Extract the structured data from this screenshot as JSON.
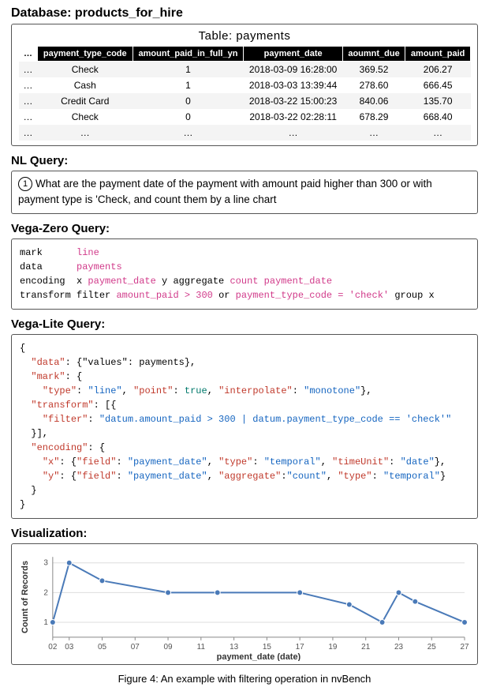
{
  "database_label": "Database: products_for_hire",
  "table": {
    "caption": "Table: payments",
    "headers": [
      "…",
      "payment_type_code",
      "amount_paid_in_full_yn",
      "payment_date",
      "aoumnt_due",
      "amount_paid"
    ],
    "rows": [
      [
        "…",
        "Check",
        "1",
        "2018-03-09 16:28:00",
        "369.52",
        "206.27"
      ],
      [
        "…",
        "Cash",
        "1",
        "2018-03-03 13:39:44",
        "278.60",
        "666.45"
      ],
      [
        "…",
        "Credit Card",
        "0",
        "2018-03-22 15:00:23",
        "840.06",
        "135.70"
      ],
      [
        "…",
        "Check",
        "0",
        "2018-03-22 02:28:11",
        "678.29",
        "668.40"
      ],
      [
        "…",
        "…",
        "…",
        "…",
        "…",
        "…"
      ]
    ]
  },
  "sections": {
    "nl_title": "NL Query:",
    "nl_text": "What are the payment date of the payment with amount paid higher than 300 or with payment type is 'Check, and count them by a line chart",
    "vz_title": "Vega-Zero Query:",
    "vl_title": "Vega-Lite Query:",
    "viz_title": "Visualization:"
  },
  "vega_zero": {
    "l1_kw": "mark",
    "l1_val": "line",
    "l2_kw": "data",
    "l2_val": "payments",
    "l3_kw": "encoding",
    "l3_a": "x",
    "l3_b": "payment_date",
    "l3_c": "y aggregate",
    "l3_d": "count payment_date",
    "l4_kw": "transform",
    "l4_a": "filter",
    "l4_b": "amount_paid > 300",
    "l4_c": "or",
    "l4_d": "payment_type_code = 'check'",
    "l4_e": "group x"
  },
  "vega_lite": {
    "open": "{",
    "data_k": "\"data\"",
    "data_v": ": {\"values\": payments},",
    "mark_k": "\"mark\"",
    "mark_open": ": {",
    "mark_type_k": "\"type\"",
    "mark_type_v": "\"line\"",
    "mark_point_k": "\"point\"",
    "mark_point_v": "true",
    "mark_interp_k": "\"interpolate\"",
    "mark_interp_v": "\"monotone\"",
    "transform_k": "\"transform\"",
    "transform_open": ": [{",
    "filter_k": "\"filter\"",
    "filter_v": "\"datum.amount_paid > 300 | datum.payment_type_code == 'check'\"",
    "transform_close": "}],",
    "encoding_k": "\"encoding\"",
    "encoding_open": ": {",
    "x_k": "\"x\"",
    "x_field_k": "\"field\"",
    "x_field_v": "\"payment_date\"",
    "x_type_k": "\"type\"",
    "x_type_v": "\"temporal\"",
    "x_tu_k": "\"timeUnit\"",
    "x_tu_v": "\"date\"",
    "y_k": "\"y\"",
    "y_field_k": "\"field\"",
    "y_field_v": "\"payment_date\"",
    "y_agg_k": "\"aggregate\"",
    "y_agg_v": "\"count\"",
    "y_type_k": "\"type\"",
    "y_type_v": "\"temporal\"",
    "close": "}"
  },
  "chart_data": {
    "type": "line",
    "xlabel": "payment_date (date)",
    "ylabel": "Count of Records",
    "x_ticks": [
      "02",
      "03",
      "05",
      "07",
      "09",
      "11",
      "13",
      "15",
      "17",
      "19",
      "21",
      "23",
      "25",
      "27"
    ],
    "y_ticks": [
      "1",
      "2",
      "3"
    ],
    "ylim": [
      0.5,
      3.2
    ],
    "series": [
      {
        "name": "count",
        "points": [
          {
            "x": 2,
            "y": 1
          },
          {
            "x": 3,
            "y": 3
          },
          {
            "x": 5,
            "y": 2.4
          },
          {
            "x": 9,
            "y": 2
          },
          {
            "x": 12,
            "y": 2
          },
          {
            "x": 17,
            "y": 2
          },
          {
            "x": 20,
            "y": 1.6
          },
          {
            "x": 22,
            "y": 1
          },
          {
            "x": 23,
            "y": 2
          },
          {
            "x": 24,
            "y": 1.7
          },
          {
            "x": 27,
            "y": 1
          }
        ]
      }
    ]
  },
  "figure_caption": "Figure 4: An example with filtering operation in nvBench"
}
